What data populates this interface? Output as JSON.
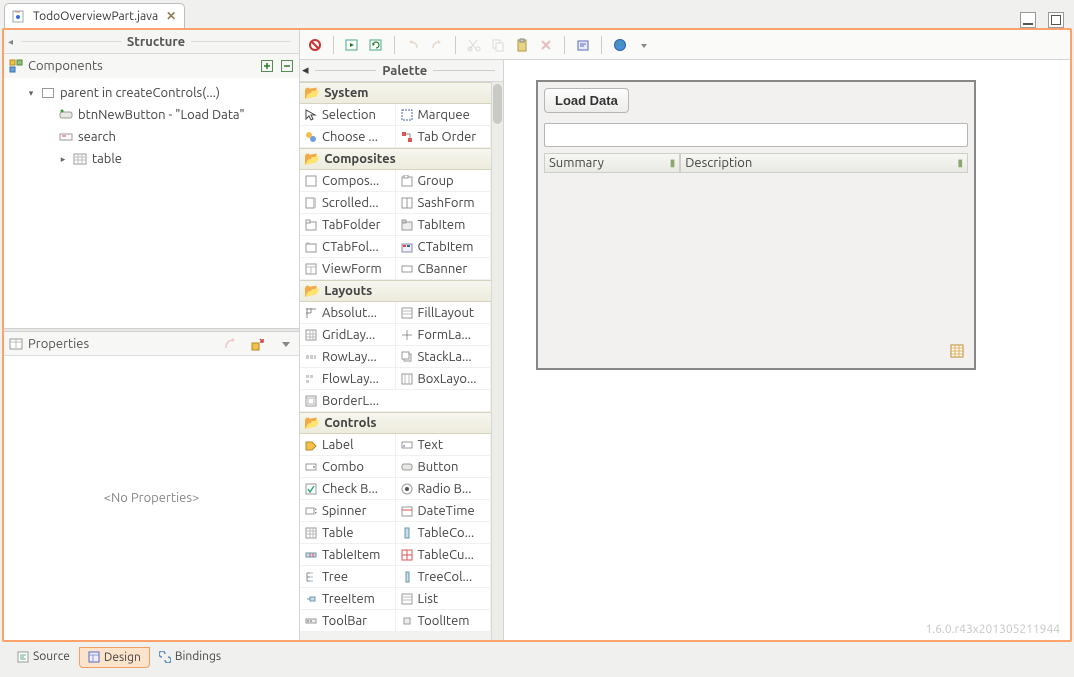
{
  "tab": {
    "title": "TodoOverviewPart.java"
  },
  "structure": {
    "title": "Structure",
    "components_label": "Components",
    "tree": {
      "root": "parent in createControls(...)",
      "child_button": "btnNewButton - \"Load Data\"",
      "child_search": "search",
      "child_table": "table"
    }
  },
  "properties": {
    "label": "Properties",
    "empty": "<No Properties>"
  },
  "palette": {
    "title": "Palette",
    "groups": {
      "system": {
        "label": "System",
        "items": [
          "Selection",
          "Marquee",
          "Choose ...",
          "Tab Order"
        ]
      },
      "composites": {
        "label": "Composites",
        "items": [
          "Compos...",
          "Group",
          "Scrolled...",
          "SashForm",
          "TabFolder",
          "TabItem",
          "CTabFol...",
          "CTabItem",
          "ViewForm",
          "CBanner"
        ]
      },
      "layouts": {
        "label": "Layouts",
        "items": [
          "Absolut...",
          "FillLayout",
          "GridLay...",
          "FormLa...",
          "RowLay...",
          "StackLa...",
          "FlowLay...",
          "BoxLayo...",
          "BorderL..."
        ]
      },
      "controls": {
        "label": "Controls",
        "items": [
          "Label",
          "Text",
          "Combo",
          "Button",
          "Check B...",
          "Radio B...",
          "Spinner",
          "DateTime",
          "Table",
          "TableCo...",
          "TableItem",
          "TableCu...",
          "Tree",
          "TreeCol...",
          "TreeItem",
          "List",
          "ToolBar",
          "ToolItem"
        ]
      }
    }
  },
  "preview": {
    "button_label": "Load Data",
    "col_summary": "Summary",
    "col_description": "Description"
  },
  "bottom_tabs": {
    "source": "Source",
    "design": "Design",
    "bindings": "Bindings"
  },
  "version": "1.6.0.r43x201305211944"
}
